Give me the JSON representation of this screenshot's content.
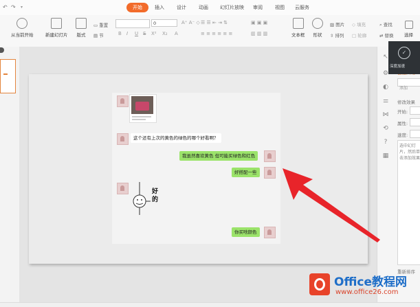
{
  "tabs": [
    {
      "id": "start",
      "label": "开始",
      "active": true
    },
    {
      "id": "insert",
      "label": "插入"
    },
    {
      "id": "design",
      "label": "设计"
    },
    {
      "id": "animation",
      "label": "动画"
    },
    {
      "id": "slideshow",
      "label": "幻灯片放映"
    },
    {
      "id": "review",
      "label": "审阅"
    },
    {
      "id": "view",
      "label": "视图"
    },
    {
      "id": "cloud",
      "label": "云服务"
    }
  ],
  "ribbon": {
    "from_current": "从当前开始",
    "new_slide": "新建幻灯片",
    "layout": "版式",
    "reset": "重置",
    "section": "节",
    "font_size": "0",
    "format_buttons": [
      "B",
      "I",
      "U",
      "S",
      "X²",
      "X₂",
      "A"
    ],
    "textbox": "文本框",
    "shape": "形状",
    "picture": "图片",
    "fill": "填充",
    "arrange": "排列",
    "outline": "轮廓",
    "find": "查找",
    "replace": "替换",
    "select": "选择"
  },
  "chat": {
    "question": "这个还有上次的黄色的绿色的哪个好看啊？",
    "reply1": "我虽然喜欢黄色 但可能买绿色和红色",
    "reply2": "好搭配一些",
    "sticker_text": "好的",
    "reply3": "你买啥颜色"
  },
  "right_panel": {
    "title": "自定义动",
    "add_effect": "添加",
    "modify": "修改效果",
    "start": "开始:",
    "property": "属性:",
    "speed": "速度:",
    "hint": "选中幻灯片，然后单击添加效果",
    "reorder": "重新排序"
  },
  "popup": {
    "label": "深度加速"
  },
  "watermark": {
    "brand": "Office教程网",
    "url": "www.office26.com"
  },
  "colors": {
    "accent": "#f26b2a",
    "bubble_green": "#9be36a",
    "arrow": "#e8242a"
  }
}
